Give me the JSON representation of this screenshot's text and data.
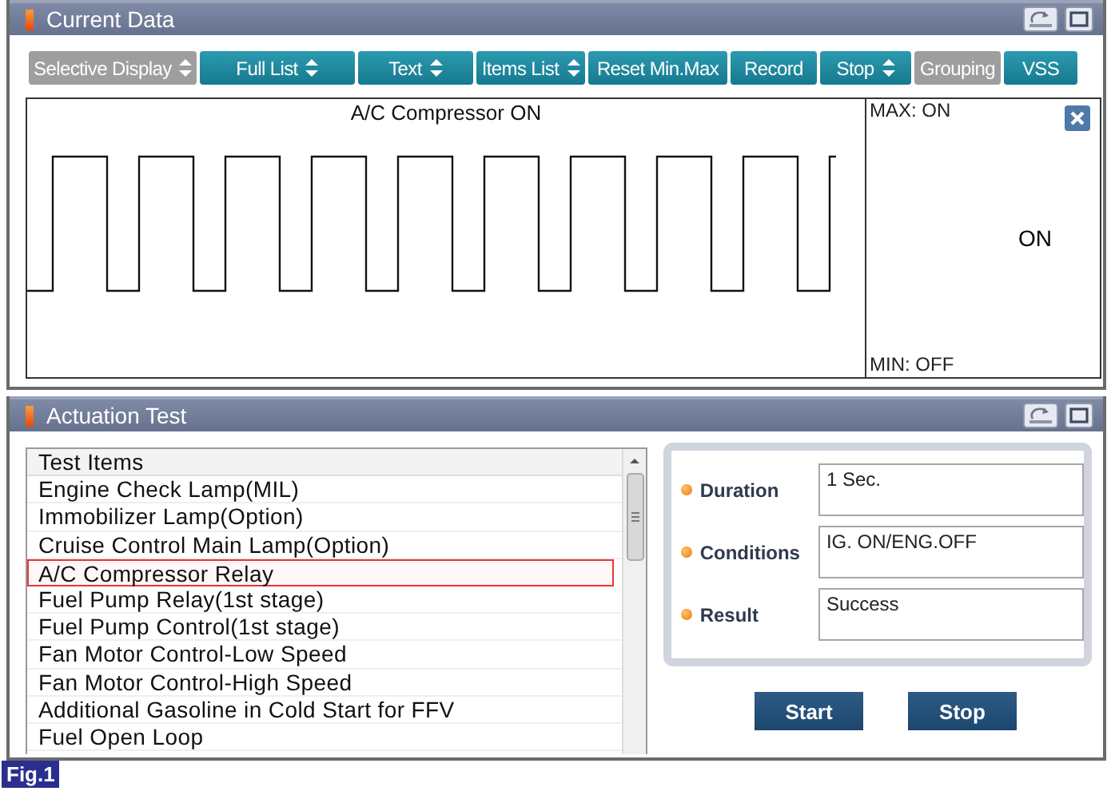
{
  "current_data": {
    "title": "Current Data",
    "toolbar": [
      {
        "label": "Selective Display",
        "kind": "dropdown",
        "disabled": true
      },
      {
        "label": "Full List",
        "kind": "dropdown",
        "disabled": false
      },
      {
        "label": "Text",
        "kind": "dropdown",
        "disabled": false
      },
      {
        "label": "Items List",
        "kind": "dropdown",
        "disabled": false
      },
      {
        "label": "Reset Min.Max",
        "kind": "plain",
        "disabled": false
      },
      {
        "label": "Record",
        "kind": "plain",
        "disabled": false
      },
      {
        "label": "Stop",
        "kind": "dropdown",
        "disabled": false
      },
      {
        "label": "Grouping",
        "kind": "plain",
        "disabled": true
      },
      {
        "label": "VSS",
        "kind": "plain",
        "disabled": false
      }
    ],
    "graph": {
      "title": "A/C Compressor ON",
      "max": "MAX: ON",
      "value": "ON",
      "min": "MIN: OFF"
    }
  },
  "actuation_test": {
    "title": "Actuation Test",
    "list_header": "Test Items",
    "items": [
      {
        "label": "Engine Check Lamp(MIL)",
        "selected": false
      },
      {
        "label": "Immobilizer Lamp(Option)",
        "selected": false
      },
      {
        "label": "Cruise Control Main Lamp(Option)",
        "selected": false
      },
      {
        "label": "A/C Compressor Relay",
        "selected": true
      },
      {
        "label": "Fuel Pump Relay(1st stage)",
        "selected": false
      },
      {
        "label": "Fuel Pump Control(1st stage)",
        "selected": false
      },
      {
        "label": "Fan Motor Control-Low Speed",
        "selected": false
      },
      {
        "label": "Fan Motor Control-High Speed",
        "selected": false
      },
      {
        "label": "Additional Gasoline in Cold Start for FFV",
        "selected": false
      },
      {
        "label": "Fuel Open Loop",
        "selected": false
      }
    ],
    "fields": [
      {
        "label": "Duration",
        "value": "1 Sec."
      },
      {
        "label": "Conditions",
        "value": "IG. ON/ENG.OFF"
      },
      {
        "label": "Result",
        "value": "Success"
      }
    ],
    "buttons": [
      "Start",
      "Stop"
    ]
  },
  "figure_label": "Fig.1"
}
